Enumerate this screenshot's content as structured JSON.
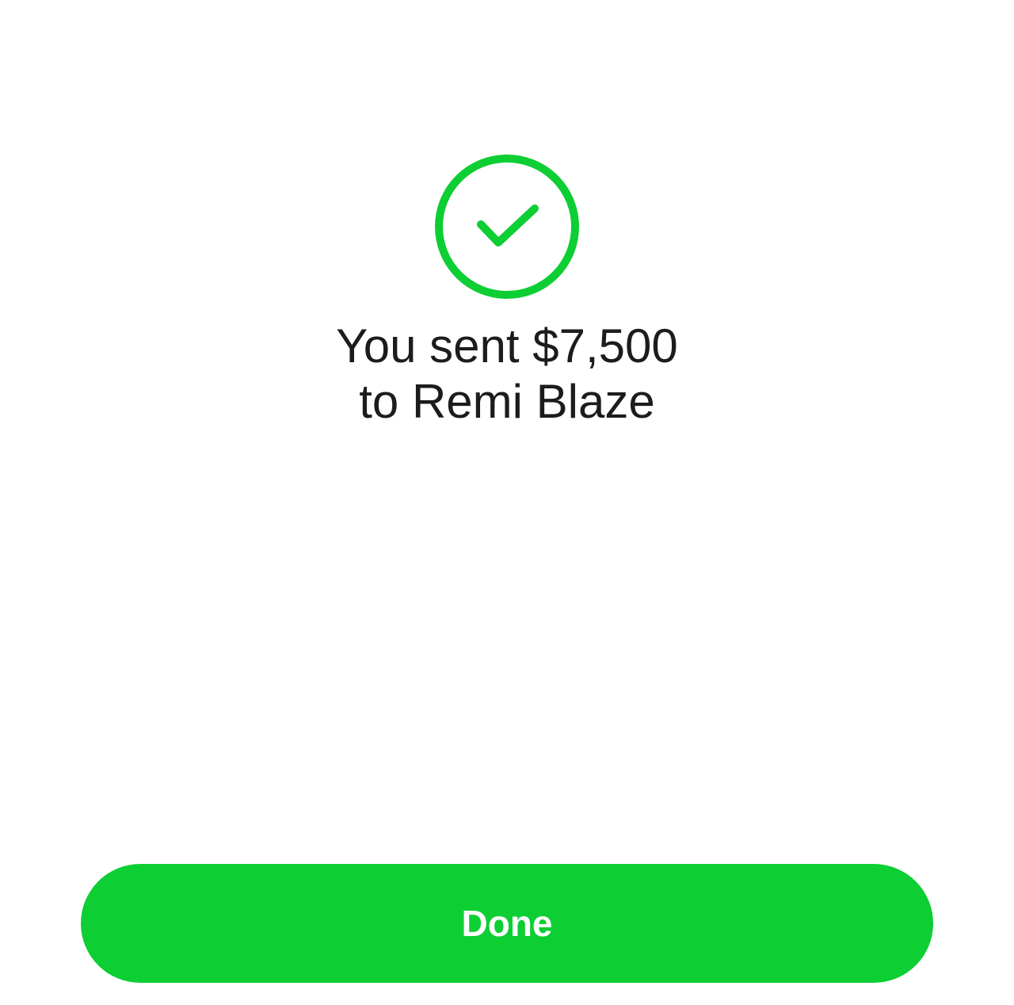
{
  "status": {
    "icon": "check-circle-icon",
    "color": "#0dce33"
  },
  "message": {
    "line1": "You sent $7,500",
    "line2": "to Remi Blaze"
  },
  "actions": {
    "done_label": "Done",
    "done_color": "#0dce33"
  }
}
